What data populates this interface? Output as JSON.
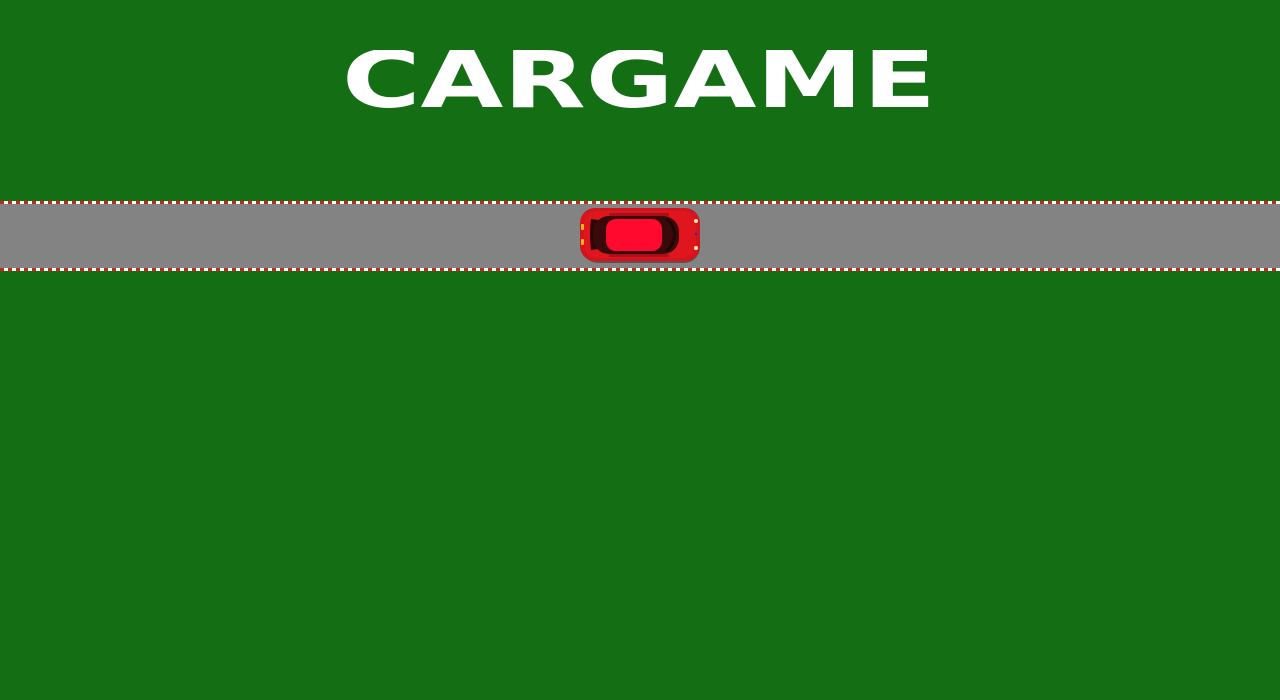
{
  "game": {
    "title": "CARGAME",
    "player_car": {
      "icon": "red-car-topdown-icon",
      "color": "#e0161e"
    }
  },
  "colors": {
    "grass": "#136e14",
    "road": "#838383",
    "curb_red": "#c8241a",
    "curb_white": "#ffffff",
    "title": "#ffffff"
  }
}
